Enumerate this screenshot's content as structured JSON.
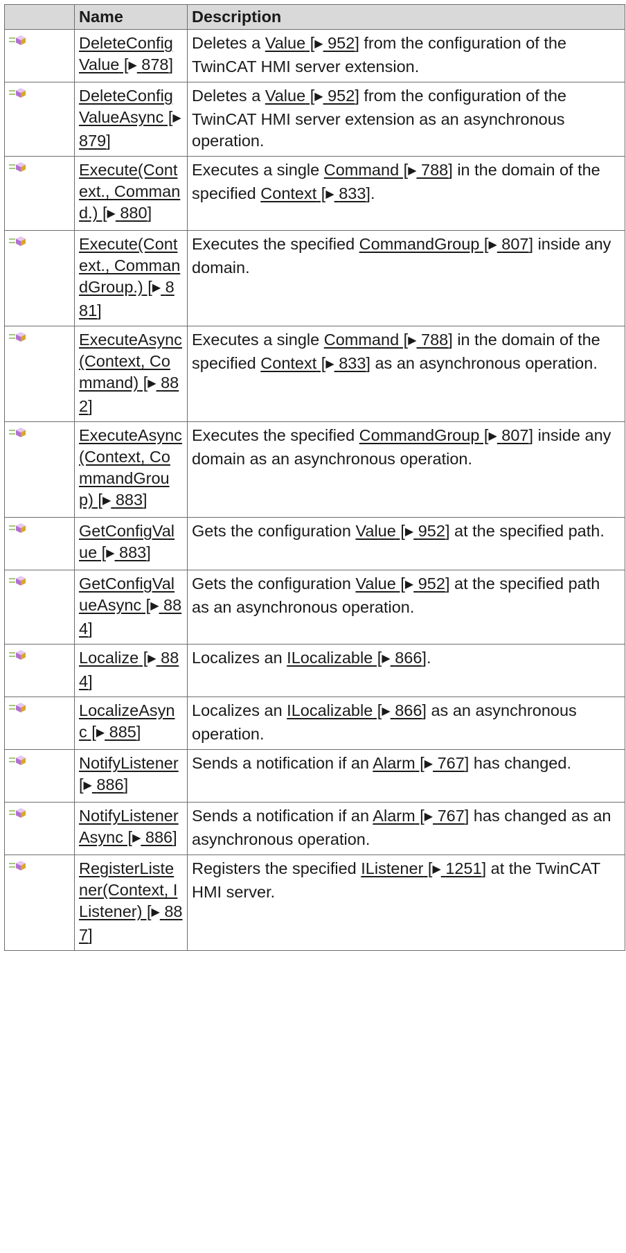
{
  "table": {
    "headers": [
      "",
      "Name",
      "Description"
    ],
    "rows": [
      {
        "icon": "method-icon",
        "name": "DeleteConfigValue",
        "name_page": "878",
        "desc": [
          {
            "t": "Deletes a "
          },
          {
            "link": "Value",
            "page": "952"
          },
          {
            "t": " from the configuration of the TwinCAT HMI server extension."
          }
        ]
      },
      {
        "icon": "method-icon",
        "name": "DeleteConfigValueAsync",
        "name_page": "879",
        "desc": [
          {
            "t": "Deletes a "
          },
          {
            "link": "Value",
            "page": "952"
          },
          {
            "t": " from the configuration of the TwinCAT HMI server extension as an asynchronous operation."
          }
        ]
      },
      {
        "icon": "method-icon",
        "name": "Execute(Context., Command.)",
        "name_page": "880",
        "desc": [
          {
            "t": "Executes a single "
          },
          {
            "link": "Command",
            "page": "788"
          },
          {
            "t": " in the domain of the specified "
          },
          {
            "link": "Context",
            "page": "833"
          },
          {
            "t": "."
          }
        ]
      },
      {
        "icon": "method-icon",
        "name": "Execute(Context., CommandGroup.)",
        "name_page": "881",
        "desc": [
          {
            "t": "Executes the specified "
          },
          {
            "link": "CommandGroup",
            "page": "807"
          },
          {
            "t": " inside any domain."
          }
        ]
      },
      {
        "icon": "method-icon",
        "name": "ExecuteAsync(Context, Command)",
        "name_page": "882",
        "desc": [
          {
            "t": "Executes a single "
          },
          {
            "link": "Command",
            "page": "788"
          },
          {
            "t": " in the domain of the specified "
          },
          {
            "link": "Context",
            "page": "833"
          },
          {
            "t": " as an asynchronous operation."
          }
        ]
      },
      {
        "icon": "method-icon",
        "name": "ExecuteAsync(Context, CommandGroup)",
        "name_page": "883",
        "desc": [
          {
            "t": "Executes the specified "
          },
          {
            "link": "CommandGroup",
            "page": "807"
          },
          {
            "t": " inside any domain as an asynchronous operation."
          }
        ]
      },
      {
        "icon": "method-icon",
        "name": "GetConfigValue",
        "name_page": "883",
        "desc": [
          {
            "t": "Gets the configuration "
          },
          {
            "link": "Value",
            "page": "952"
          },
          {
            "t": " at the specified path."
          }
        ]
      },
      {
        "icon": "method-icon",
        "name": "GetConfigValueAsync",
        "name_page": "884",
        "desc": [
          {
            "t": "Gets the configuration "
          },
          {
            "link": "Value",
            "page": "952"
          },
          {
            "t": " at the specified path as an asynchronous operation."
          }
        ]
      },
      {
        "icon": "method-icon",
        "name": "Localize",
        "name_page": "884",
        "desc": [
          {
            "t": "Localizes an "
          },
          {
            "link": "ILocalizable",
            "page": "866"
          },
          {
            "t": "."
          }
        ]
      },
      {
        "icon": "method-icon",
        "name": "LocalizeAsync",
        "name_page": "885",
        "desc": [
          {
            "t": "Localizes an "
          },
          {
            "link": "ILocalizable",
            "page": "866"
          },
          {
            "t": " as an asynchronous operation."
          }
        ]
      },
      {
        "icon": "method-icon",
        "name": "NotifyListener",
        "name_page": "886",
        "desc": [
          {
            "t": "Sends a notification if an "
          },
          {
            "link": "Alarm",
            "page": "767"
          },
          {
            "t": " has changed."
          }
        ]
      },
      {
        "icon": "method-icon",
        "name": "NotifyListenerAsync",
        "name_page": "886",
        "desc": [
          {
            "t": "Sends a notification if an "
          },
          {
            "link": "Alarm",
            "page": "767"
          },
          {
            "t": " has changed as an asynchronous operation."
          }
        ]
      },
      {
        "icon": "method-icon",
        "name": "RegisterListener(Context, IListener)",
        "name_page": "887",
        "desc": [
          {
            "t": "Registers the specified "
          },
          {
            "link": "IListener",
            "page": "1251"
          },
          {
            "t": " at the TwinCAT HMI server."
          }
        ]
      }
    ]
  }
}
